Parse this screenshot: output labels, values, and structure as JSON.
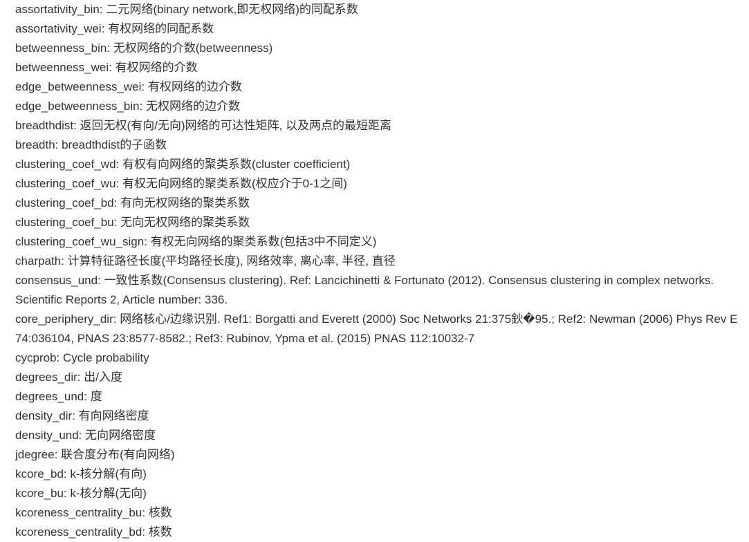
{
  "entries": [
    "assortativity_bin: 二元网络(binary network,即无权网络)的同配系数",
    "assortativity_wei: 有权网络的同配系数",
    "betweenness_bin: 无权网络的介数(betweenness)",
    "betweenness_wei: 有权网络的介数",
    "edge_betweenness_wei: 有权网络的边介数",
    "edge_betweenness_bin: 无权网络的边介数",
    "breadthdist: 返回无权(有向/无向)网络的可达性矩阵, 以及两点的最短距离",
    "breadth: breadthdist的子函数",
    "clustering_coef_wd: 有权有向网络的聚类系数(cluster coefficient)",
    "clustering_coef_wu: 有权无向网络的聚类系数(权应介于0-1之间)",
    "clustering_coef_bd: 有向无权网络的聚类系数",
    "clustering_coef_bu: 无向无权网络的聚类系数",
    "clustering_coef_wu_sign: 有权无向网络的聚类系数(包括3中不同定义)",
    "charpath: 计算特征路径长度(平均路径长度), 网络效率, 离心率, 半径, 直径",
    "consensus_und: 一致性系数(Consensus clustering). Ref: Lancichinetti & Fortunato (2012). Consensus clustering in complex networks. Scientific Reports 2, Article number: 336.",
    "core_periphery_dir: 网络核心/边缘识别. Ref1: Borgatti and Everett (2000) Soc Networks 21:375鈥�95.; Ref2: Newman (2006) Phys Rev E 74:036104, PNAS 23:8577-8582.; Ref3: Rubinov, Ypma et al. (2015) PNAS 112:10032-7",
    "cycprob: Cycle probability",
    "degrees_dir: 出/入度",
    "degrees_und: 度",
    "density_dir: 有向网络密度",
    "density_und: 无向网络密度",
    "jdegree: 联合度分布(有向网络)",
    "kcore_bd: k-核分解(有向)",
    "kcore_bu: k-核分解(无向)",
    "kcoreness_centrality_bu: 核数",
    "kcoreness_centrality_bd: 核数"
  ],
  "colors": {
    "text": "#333333",
    "background": "#ffffff"
  }
}
